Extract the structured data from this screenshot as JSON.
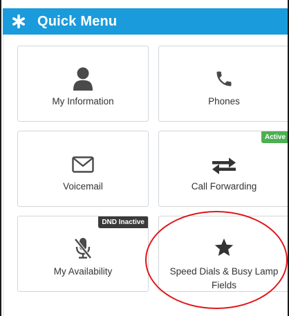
{
  "header": {
    "title": "Quick Menu",
    "icon": "asterisk-icon",
    "color": "#1a9bdb"
  },
  "tiles": [
    {
      "label": "My Information",
      "icon": "user-icon"
    },
    {
      "label": "Phones",
      "icon": "phone-icon"
    },
    {
      "label": "Voicemail",
      "icon": "envelope-icon"
    },
    {
      "label": "Call Forwarding",
      "icon": "exchange-arrows-icon",
      "badge": "Active",
      "badge_color": "#4caf50"
    },
    {
      "label": "My Availability",
      "icon": "microphone-slash-icon",
      "badge": "DND Inactive",
      "badge_color": "#3a3a3a"
    },
    {
      "label": "Speed Dials & Busy Lamp Fields",
      "icon": "star-icon"
    }
  ],
  "annotation": {
    "shape": "ellipse",
    "color": "#e0161b"
  }
}
